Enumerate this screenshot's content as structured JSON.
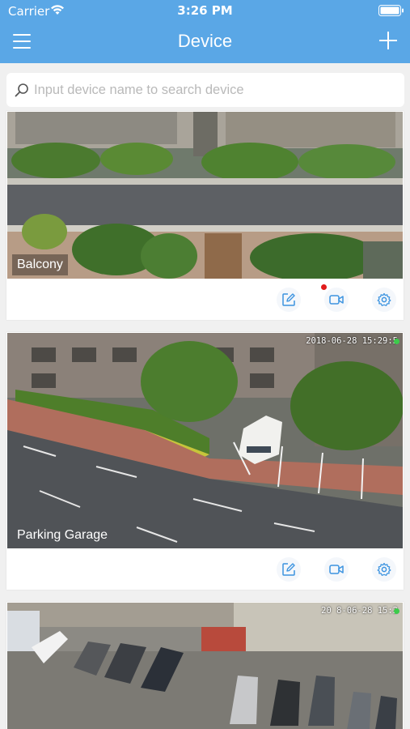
{
  "status_bar": {
    "carrier": "Carrier",
    "time": "3:26 PM"
  },
  "nav": {
    "title": "Device",
    "menu_icon": "hamburger-menu-icon",
    "add_icon": "plus-icon"
  },
  "search": {
    "placeholder": "Input device name to search device",
    "value": "",
    "icon": "search-icon"
  },
  "colors": {
    "header_bg": "#5aa7e6",
    "accent": "#3d94e0",
    "alert": "#e11b1b",
    "online": "#3ccb4b"
  },
  "devices": [
    {
      "name": "Balcony",
      "osd_timestamp": "",
      "has_alert": true,
      "actions": [
        "edit-icon",
        "video-camera-icon",
        "gear-icon"
      ]
    },
    {
      "name": "Parking Garage",
      "osd_timestamp": "2018-06-28  15:29:5",
      "has_alert": false,
      "actions": [
        "edit-icon",
        "video-camera-icon",
        "gear-icon"
      ]
    },
    {
      "name": "",
      "osd_timestamp": "20 8-06-28  15:2",
      "has_alert": false,
      "actions": []
    }
  ]
}
